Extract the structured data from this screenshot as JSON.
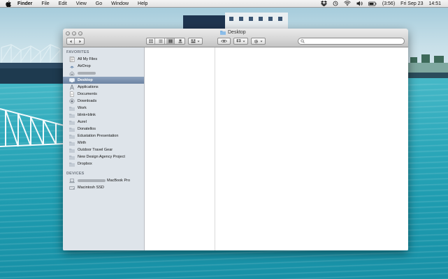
{
  "menubar": {
    "app_name": "Finder",
    "menus": [
      "File",
      "Edit",
      "View",
      "Go",
      "Window",
      "Help"
    ],
    "battery": "(3:56)",
    "date": "Fri Sep 23",
    "time": "14:51"
  },
  "window": {
    "title": "Desktop",
    "search_placeholder": ""
  },
  "sidebar": {
    "favorites_heading": "FAVORITES",
    "favorites": [
      {
        "label": "All My Files",
        "icon": "all-files-icon"
      },
      {
        "label": "AirDrop",
        "icon": "airdrop-icon"
      },
      {
        "label": "",
        "icon": "home-icon",
        "redacted": true
      },
      {
        "label": "Desktop",
        "icon": "desktop-icon",
        "selected": true
      },
      {
        "label": "Applications",
        "icon": "applications-icon"
      },
      {
        "label": "Documents",
        "icon": "documents-icon"
      },
      {
        "label": "Downloads",
        "icon": "downloads-icon"
      },
      {
        "label": "Work",
        "icon": "folder-icon"
      },
      {
        "label": "blink+blink",
        "icon": "folder-icon"
      },
      {
        "label": "Aurel",
        "icon": "folder-icon"
      },
      {
        "label": "Donatellos",
        "icon": "folder-icon"
      },
      {
        "label": "Edustation Presentation",
        "icon": "folder-icon"
      },
      {
        "label": "Mirth",
        "icon": "folder-icon"
      },
      {
        "label": "Outdoor Travel Gear",
        "icon": "folder-icon"
      },
      {
        "label": "New Design Agency Project",
        "icon": "folder-icon"
      },
      {
        "label": "Dropbox",
        "icon": "folder-icon"
      }
    ],
    "devices_heading": "DEVICES",
    "devices": [
      {
        "label": "MacBook Pro",
        "icon": "laptop-icon",
        "redacted_prefix": true
      },
      {
        "label": "Macintosh SSD",
        "icon": "hard-drive-icon"
      }
    ]
  },
  "colors": {
    "selection": "#7a90ad",
    "sidebar_bg": "#dee4ea",
    "sea": "#2aa6b8"
  }
}
